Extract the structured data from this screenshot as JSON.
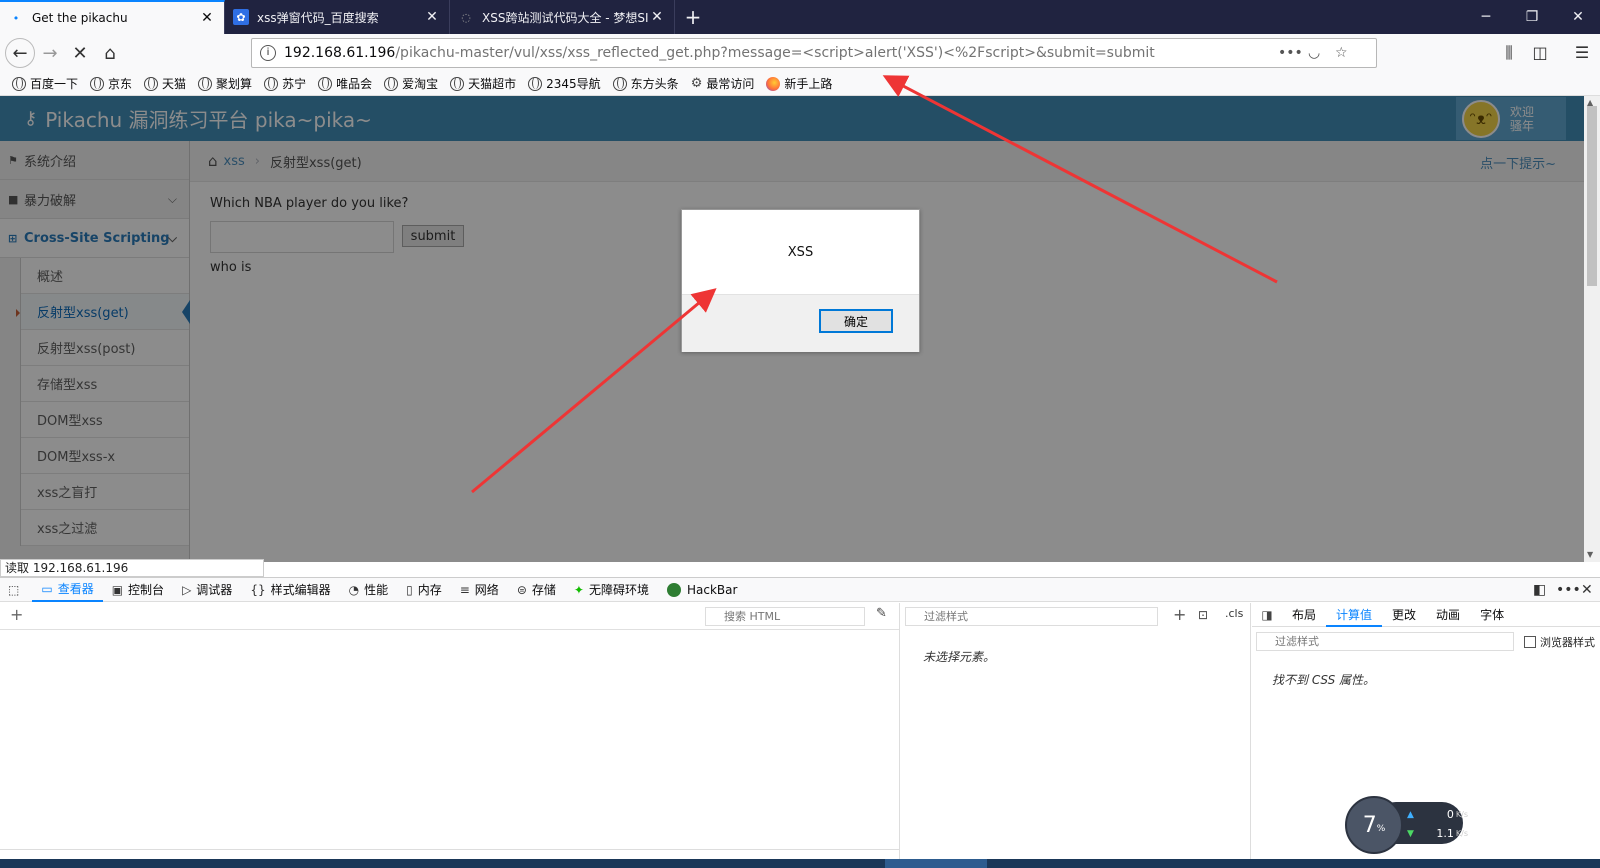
{
  "tabs": [
    {
      "title": "Get the pikachu",
      "active": true
    },
    {
      "title": "xss弹窗代码_百度搜索",
      "active": false
    },
    {
      "title": "XSS跨站测试代码大全 - 梦想SI",
      "active": false
    }
  ],
  "url": {
    "host": "192.168.61.196",
    "path": "/pikachu-master/vul/xss/xss_reflected_get.php?message=<script>alert('XSS')<%2Fscript>&submit=submit"
  },
  "bookmarks": [
    "百度一下",
    "京东",
    "天猫",
    "聚划算",
    "苏宁",
    "唯品会",
    "爱淘宝",
    "天猫超市",
    "2345导航",
    "东方头条",
    "最常访问",
    "新手上路"
  ],
  "site": {
    "title": "Pikachu 漏洞练习平台 pika~pika~",
    "welcome_line1": "欢迎",
    "welcome_line2": "骚年"
  },
  "sidebar": {
    "items": [
      "系统介绍",
      "暴力破解",
      "Cross-Site Scripting"
    ],
    "sub_items": [
      "概述",
      "反射型xss(get)",
      "反射型xss(post)",
      "存储型xss",
      "DOM型xss",
      "DOM型xss-x",
      "xss之盲打",
      "xss之过滤"
    ]
  },
  "breadcrumb": {
    "link": "xss",
    "current": "反射型xss(get)",
    "hint": "点一下提示~"
  },
  "form": {
    "question": "Which NBA player do you like?",
    "input_value": "",
    "submit_label": "submit",
    "result": "who is"
  },
  "alert": {
    "message": "XSS",
    "ok_label": "确定"
  },
  "status_text": "读取 192.168.61.196",
  "devtools": {
    "tabs": [
      "查看器",
      "控制台",
      "调试器",
      "样式编辑器",
      "性能",
      "内存",
      "网络",
      "存储",
      "无障碍环境",
      "HackBar"
    ],
    "html_search_placeholder": "搜索 HTML",
    "rules_filter_placeholder": "过滤样式",
    "rules_empty": "未选择元素。",
    "cls_label": ".cls",
    "computed_tabs": [
      "布局",
      "计算值",
      "更改",
      "动画",
      "字体"
    ],
    "computed_filter_placeholder": "过滤样式",
    "browser_styles_label": "浏览器样式",
    "computed_empty": "找不到 CSS 属性。"
  },
  "net_widget": {
    "percent": "7",
    "percent_unit": "%",
    "up": "0",
    "down": "1.1",
    "unit": "K/s"
  },
  "colors": {
    "accent": "#0a84ff",
    "site_header": "#438eb9",
    "arrow": "#ee3535"
  }
}
